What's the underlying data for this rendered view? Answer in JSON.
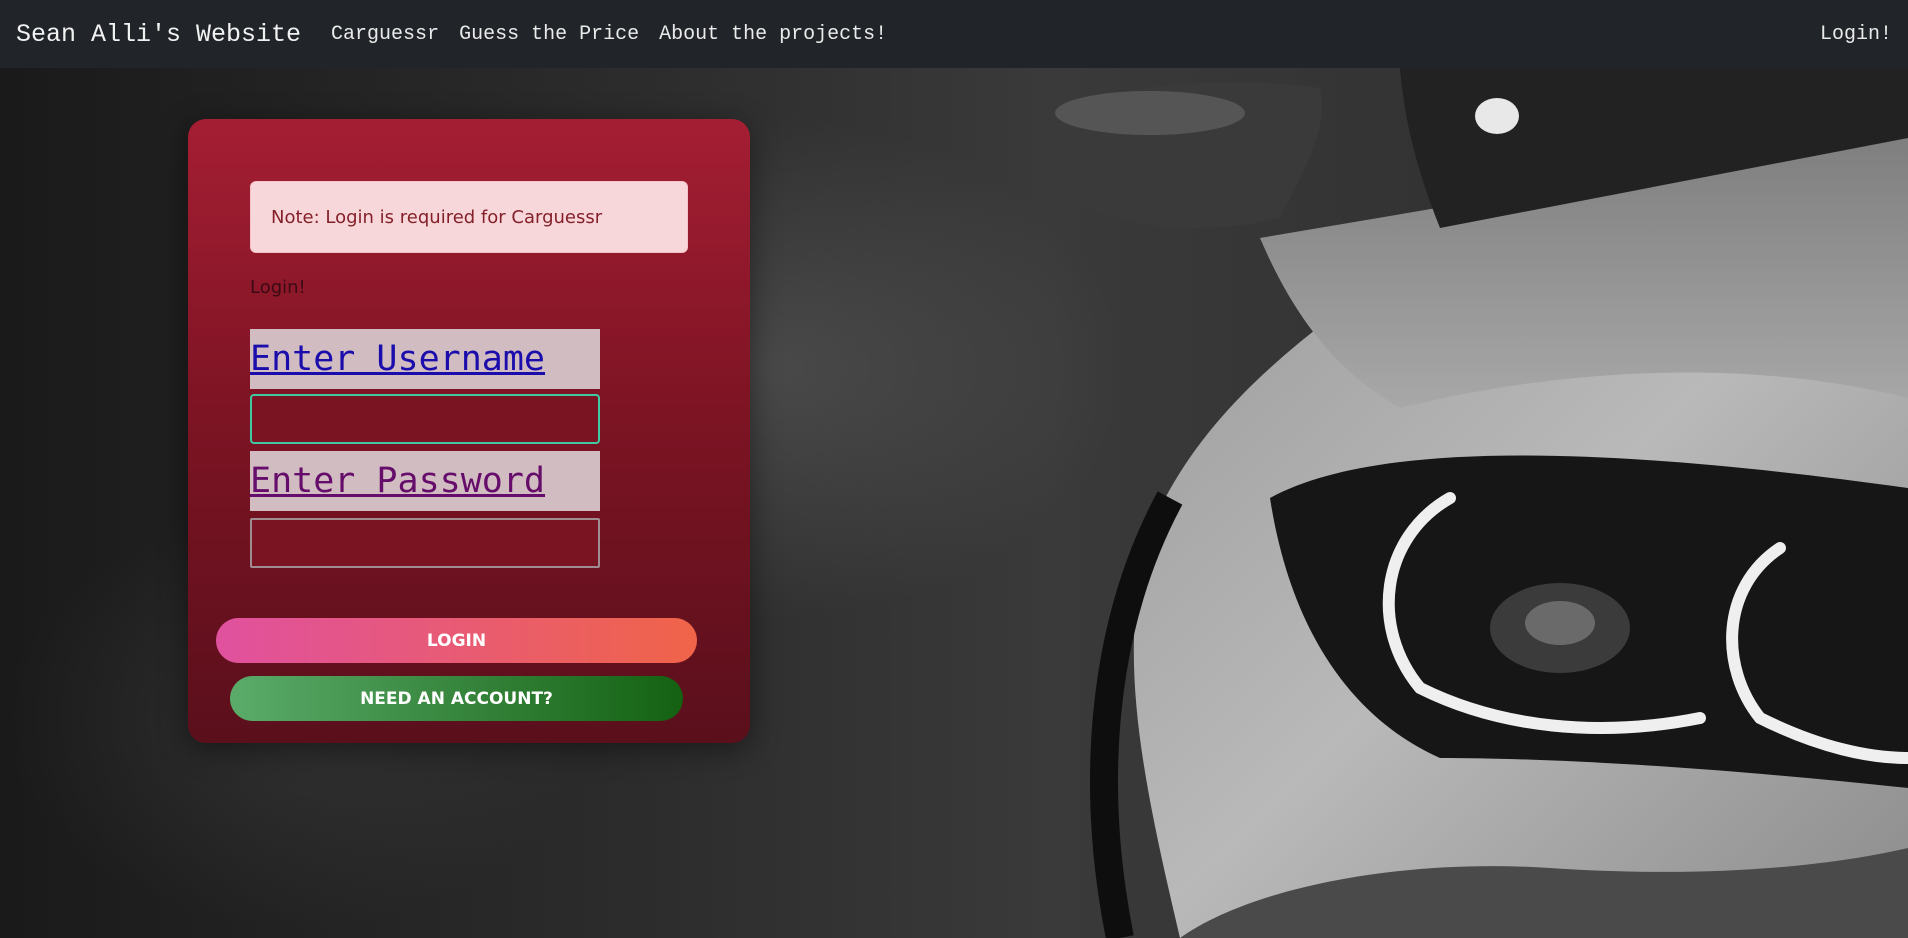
{
  "navbar": {
    "brand": "Sean Alli's Website",
    "links": [
      {
        "label": "Carguessr"
      },
      {
        "label": "Guess the Price"
      },
      {
        "label": "About the projects!"
      }
    ],
    "login_label": "Login!"
  },
  "login_card": {
    "note": "Note: Login is required for Carguessr",
    "heading": "Login!",
    "username_label": "Enter Username",
    "username_value": "",
    "password_label": "Enter Password",
    "password_value": "",
    "login_button": "LOGIN",
    "signup_button": "NEED AN ACCOUNT?"
  },
  "colors": {
    "navbar_bg": "#212529",
    "card_top": "#a51e33",
    "card_bottom": "#5a0f1b",
    "alert_bg": "#f8d7da",
    "alert_text": "#842029",
    "login_gradient": [
      "#e0519f",
      "#f06449"
    ],
    "signup_gradient": [
      "#5bab6a",
      "#146112"
    ]
  }
}
